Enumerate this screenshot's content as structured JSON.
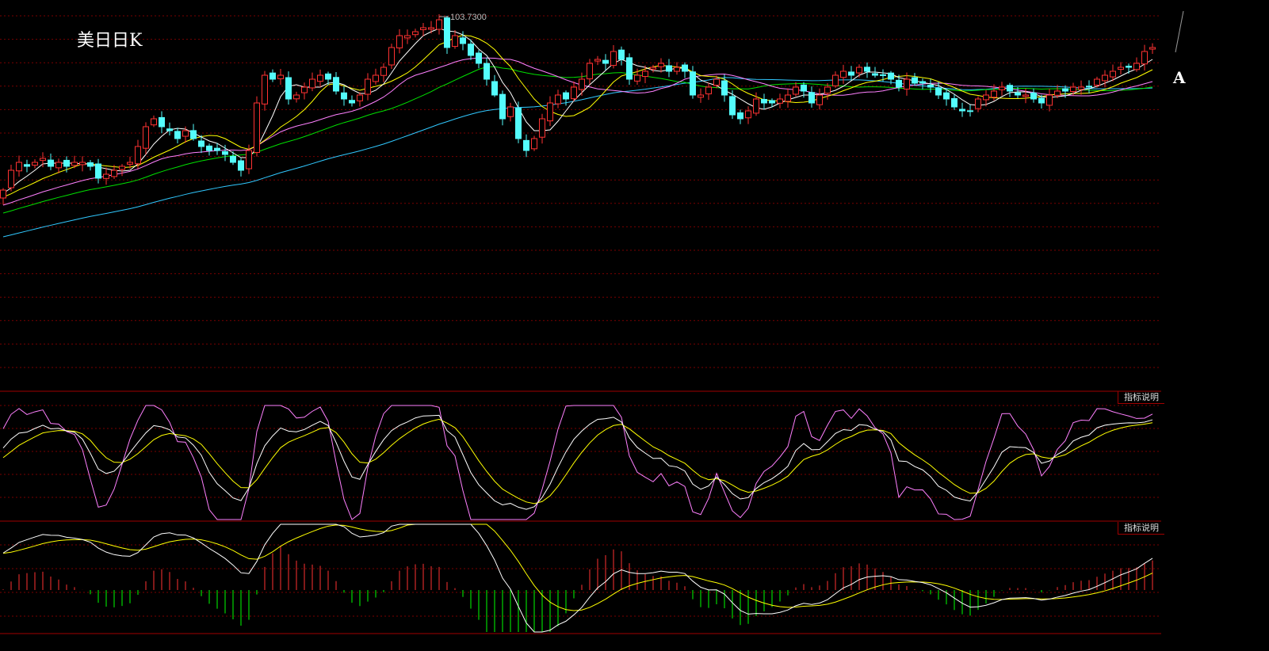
{
  "header": {
    "title": "美日日K",
    "marker": "A"
  },
  "indicator_buttons": [
    {
      "label": "指标说明"
    },
    {
      "label": "指标说明"
    }
  ],
  "colors": {
    "up": "#ff3232",
    "down": "#54fcfc",
    "grid": "#7a0000",
    "ma5": "#ffffff",
    "ma10": "#ffff00",
    "ma20": "#ff80ff",
    "ma30": "#00e000",
    "ma60": "#30c8ff",
    "k": "#ffffff",
    "d": "#ffff00",
    "j": "#ff80ff",
    "macd_up": "#ff3232",
    "macd_down": "#00ff00"
  },
  "chart_data": {
    "type": "candlestick",
    "title": "美日日K",
    "max_label": "103.7300",
    "max_value": 103.73,
    "ylim": [
      94.8,
      104.09
    ],
    "moving_averages": [
      5,
      10,
      20,
      30,
      60
    ],
    "indicators": [
      "KDJ",
      "MACD"
    ],
    "closes": [
      99.29,
      99.79,
      99.99,
      99.89,
      99.99,
      100.09,
      99.89,
      99.99,
      99.89,
      99.99,
      99.99,
      99.89,
      99.59,
      99.69,
      99.79,
      99.89,
      99.99,
      100.39,
      100.89,
      101.09,
      100.89,
      100.79,
      100.59,
      100.79,
      100.59,
      100.39,
      100.29,
      100.29,
      100.19,
      99.99,
      99.79,
      100.29,
      101.49,
      102.19,
      102.09,
      102.19,
      101.59,
      101.69,
      101.89,
      102.09,
      102.19,
      102.09,
      101.79,
      101.59,
      101.49,
      101.69,
      102.09,
      102.19,
      102.39,
      102.89,
      103.19,
      103.19,
      103.29,
      103.39,
      103.39,
      103.59,
      102.89,
      103.19,
      102.99,
      102.69,
      102.49,
      102.09,
      101.69,
      101.09,
      101.39,
      100.59,
      100.29,
      100.59,
      101.09,
      101.49,
      101.69,
      101.59,
      101.89,
      102.09,
      102.49,
      102.59,
      102.49,
      102.79,
      102.59,
      102.09,
      102.19,
      102.29,
      102.39,
      102.49,
      102.29,
      102.39,
      102.29,
      101.69,
      101.69,
      101.89,
      102.09,
      101.69,
      101.19,
      101.09,
      101.29,
      101.59,
      101.49,
      101.49,
      101.59,
      101.69,
      101.89,
      101.79,
      101.49,
      101.69,
      101.89,
      102.19,
      102.29,
      102.19,
      102.39,
      102.29,
      102.19,
      102.19,
      102.09,
      101.89,
      102.09,
      101.99,
      101.99,
      101.89,
      101.69,
      101.59,
      101.39,
      101.29,
      101.29,
      101.59,
      101.69,
      101.79,
      101.89,
      101.79,
      101.69,
      101.69,
      101.59,
      101.49,
      101.69,
      101.79,
      101.79,
      101.89,
      101.89,
      101.89,
      102.09,
      102.19,
      102.29,
      102.39,
      102.39,
      102.49,
      102.79,
      102.89
    ]
  }
}
